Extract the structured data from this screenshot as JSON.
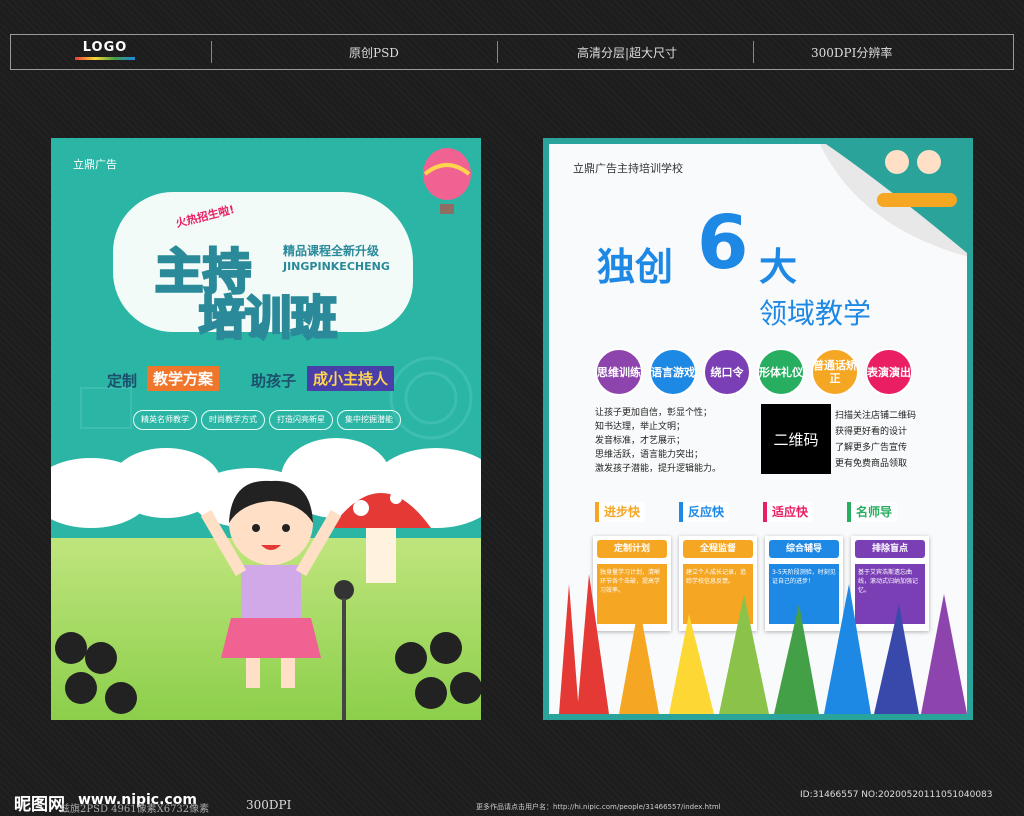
{
  "header": {
    "logo": "LOGO",
    "items": [
      "原创PSD",
      "高清分层|超大尺寸",
      "300DPI分辨率"
    ]
  },
  "poster1": {
    "brand": "立鼎广告",
    "enroll": "火热招生啦!",
    "title_line1": "主持",
    "title_line2": "培训班",
    "subtitle": "精品课程全新升级",
    "pinyin": "JINGPINKECHENG",
    "slogan_a": "定制",
    "slogan_b": "教学方案",
    "slogan_c": "助孩子",
    "slogan_d": "成小主持人",
    "pills": [
      "精英名师教学",
      "时尚教学方式",
      "打造闪亮新星",
      "集中挖掘潜能"
    ]
  },
  "poster2": {
    "school": "立鼎广告主持培训学校",
    "headline_a": "独创",
    "headline_num": "6",
    "headline_b": "大",
    "headline_sub": "领域教学",
    "circles": [
      {
        "label": "思维训练",
        "color": "#8e44ad"
      },
      {
        "label": "语言游戏",
        "color": "#1e88e5"
      },
      {
        "label": "绕口令",
        "color": "#7b3fb5"
      },
      {
        "label": "形体礼仪",
        "color": "#27ae60"
      },
      {
        "label": "普通话矫正",
        "color": "#f5a623"
      },
      {
        "label": "表演演出",
        "color": "#e91e63"
      }
    ],
    "benefits": [
      "让孩子更加自信，彰显个性；",
      "知书达理，举止文明；",
      "发音标准，才艺展示；",
      "思维活跃，语言能力突出；",
      "激发孩子潜能，提升逻辑能力。"
    ],
    "qr_label": "二维码",
    "qr_text": [
      "扫描关注店铺二维码",
      "获得更好看的设计",
      "了解更多广告宣传",
      "更有免费商品领取"
    ],
    "labels": [
      {
        "text": "进步快",
        "color": "#f5a623"
      },
      {
        "text": "反应快",
        "color": "#1e88e5"
      },
      {
        "text": "适应快",
        "color": "#e91e63"
      },
      {
        "text": "名师导",
        "color": "#27ae60"
      }
    ],
    "cards": [
      {
        "title": "定制计划",
        "color": "#f5a623",
        "body": "独身量学习计划，清晰环节各个击破，提高学习效率。"
      },
      {
        "title": "全程监督",
        "color": "#f5a623",
        "body": "建立个人成长记录，追踪学校信息反馈。"
      },
      {
        "title": "综合辅导",
        "color": "#1e88e5",
        "body": "3-5天阶段测验，时刻见证自己的进步！"
      },
      {
        "title": "排除盲点",
        "color": "#7b3fb5",
        "body": "基于艾宾浩斯遗忘曲线，滚动式归纳加强记忆。"
      }
    ]
  },
  "footer": {
    "brand": "昵图网",
    "site": "www.nipic.com",
    "specs": "兹旗2PSD  4961像素X6732像素",
    "dpi": "300DPI",
    "more": "更多作品请点击用户名：http://hi.nipic.com/people/31466557/index.html",
    "id": "ID:31466557 NO:20200520111051040083"
  },
  "colors": {
    "teal": "#2bb5a5",
    "accent": "#f5a623"
  }
}
